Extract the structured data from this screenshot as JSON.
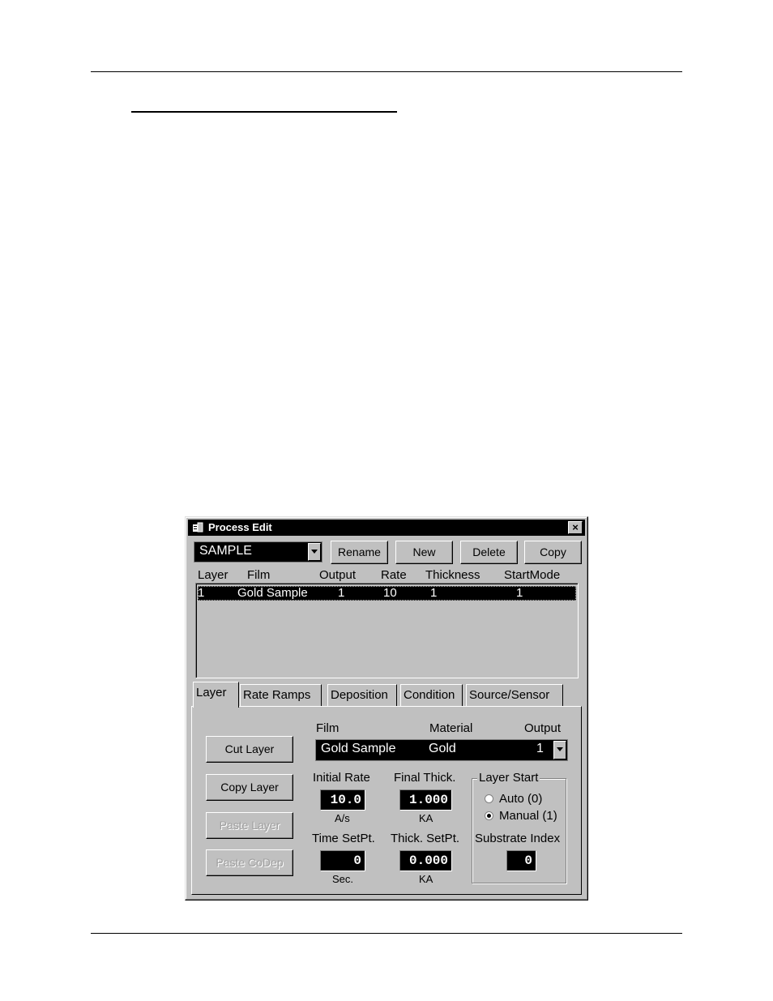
{
  "window": {
    "title": "Process Edit",
    "close_label": "×"
  },
  "toolbar": {
    "process_value": "SAMPLE",
    "rename_label": "Rename",
    "new_label": "New",
    "delete_label": "Delete",
    "copy_label": "Copy"
  },
  "layer_table": {
    "headers": [
      "Layer",
      "Film",
      "Output",
      "Rate",
      "Thickness",
      "StartMode"
    ],
    "rows": [
      {
        "layer": "1",
        "film": "Gold Sample",
        "output": "1",
        "rate": "10",
        "thickness": "1",
        "start_mode": "1",
        "selected": true
      }
    ]
  },
  "tabs": [
    "Layer",
    "Rate Ramps",
    "Deposition",
    "Condition",
    "Source/Sensor"
  ],
  "active_tab": "Layer",
  "layer_panel": {
    "buttons": {
      "cut": "Cut Layer",
      "copy": "Copy Layer",
      "paste": "Paste Layer",
      "paste_codep": "Paste CoDep"
    },
    "film_label": "Film",
    "material_label": "Material",
    "output_label": "Output",
    "combo": {
      "film": "Gold Sample",
      "material": "Gold",
      "output": "1"
    },
    "initial_rate_label": "Initial  Rate",
    "initial_rate_value": "10.0",
    "initial_rate_unit": "A/s",
    "final_thick_label": "Final Thick.",
    "final_thick_value": "1.000",
    "final_thick_unit": "KA",
    "time_setpt_label": "Time SetPt.",
    "time_setpt_value": "0",
    "time_setpt_unit": "Sec.",
    "thick_setpt_label": "Thick. SetPt.",
    "thick_setpt_value": "0.000",
    "thick_setpt_unit": "KA",
    "layer_start_label": "Layer Start",
    "auto_label": "Auto (0)",
    "manual_label": "Manual (1)",
    "layer_start_selected": "manual",
    "substrate_index_label": "Substrate Index",
    "substrate_index_value": "0"
  },
  "colors": {
    "title_bar": "#000000",
    "face": "#c0c0c0",
    "selection": "#000000"
  }
}
